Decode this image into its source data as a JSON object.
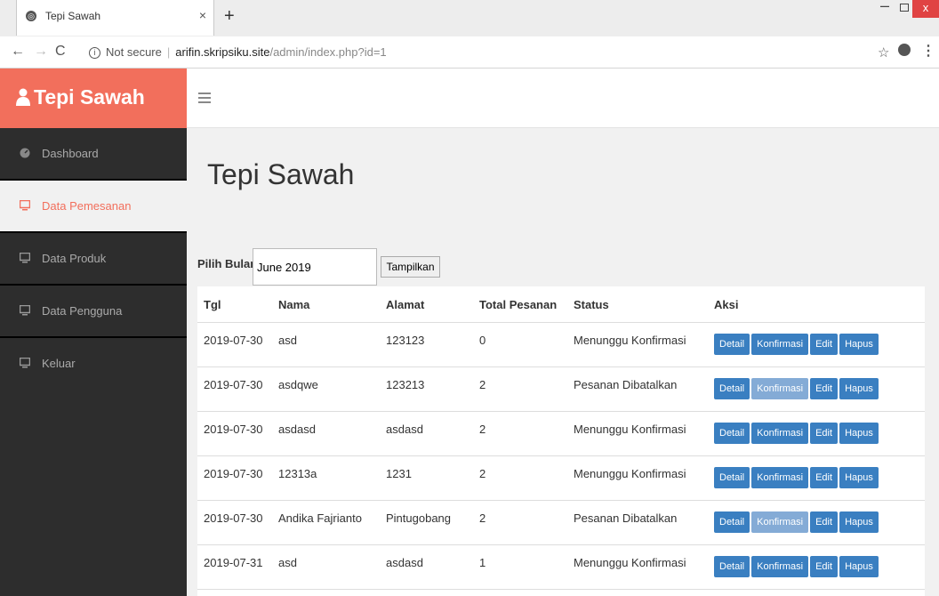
{
  "browser": {
    "tab_title": "Tepi Sawah",
    "tab_close": "×",
    "new_tab": "+",
    "security": "Not secure",
    "url_host": "arifin.skripsiku.site",
    "url_path": "/admin/index.php?id=1"
  },
  "sidebar": {
    "brand": "Tepi Sawah",
    "items": [
      {
        "label": "Dashboard",
        "icon": "dashboard-icon"
      },
      {
        "label": "Data Pemesanan",
        "icon": "monitor-icon",
        "active": true
      },
      {
        "label": "Data Produk",
        "icon": "monitor-icon"
      },
      {
        "label": "Data Pengguna",
        "icon": "monitor-icon"
      },
      {
        "label": "Keluar",
        "icon": "monitor-icon"
      }
    ]
  },
  "main": {
    "title": "Tepi Sawah",
    "filter": {
      "label": "Pilih Bulan :",
      "value": "June 2019",
      "button": "Tampilkan"
    },
    "table": {
      "headers": [
        "Tgl",
        "Nama",
        "Alamat",
        "Total Pesanan",
        "Status",
        "Aksi"
      ],
      "rows": [
        {
          "tgl": "2019-07-30",
          "nama": "asd",
          "alamat": "123123",
          "total": "0",
          "status": "Menunggu Konfirmasi",
          "konfirmasi_enabled": true
        },
        {
          "tgl": "2019-07-30",
          "nama": "asdqwe",
          "alamat": "123213",
          "total": "2",
          "status": "Pesanan Dibatalkan",
          "konfirmasi_enabled": false
        },
        {
          "tgl": "2019-07-30",
          "nama": "asdasd",
          "alamat": "asdasd",
          "total": "2",
          "status": "Menunggu Konfirmasi",
          "konfirmasi_enabled": true
        },
        {
          "tgl": "2019-07-30",
          "nama": "12313a",
          "alamat": "1231",
          "total": "2",
          "status": "Menunggu Konfirmasi",
          "konfirmasi_enabled": true
        },
        {
          "tgl": "2019-07-30",
          "nama": "Andika Fajrianto",
          "alamat": "Pintugobang",
          "total": "2",
          "status": "Pesanan Dibatalkan",
          "konfirmasi_enabled": false
        },
        {
          "tgl": "2019-07-31",
          "nama": "asd",
          "alamat": "asdasd",
          "total": "1",
          "status": "Menunggu Konfirmasi",
          "konfirmasi_enabled": true
        }
      ],
      "actions": {
        "detail": "Detail",
        "konfirmasi": "Konfirmasi",
        "edit": "Edit",
        "hapus": "Hapus"
      }
    }
  },
  "colors": {
    "brand": "#f26f5c",
    "sidebar": "#2d2d2d",
    "button": "#3a7fc1",
    "button_disabled": "#84abd6"
  }
}
